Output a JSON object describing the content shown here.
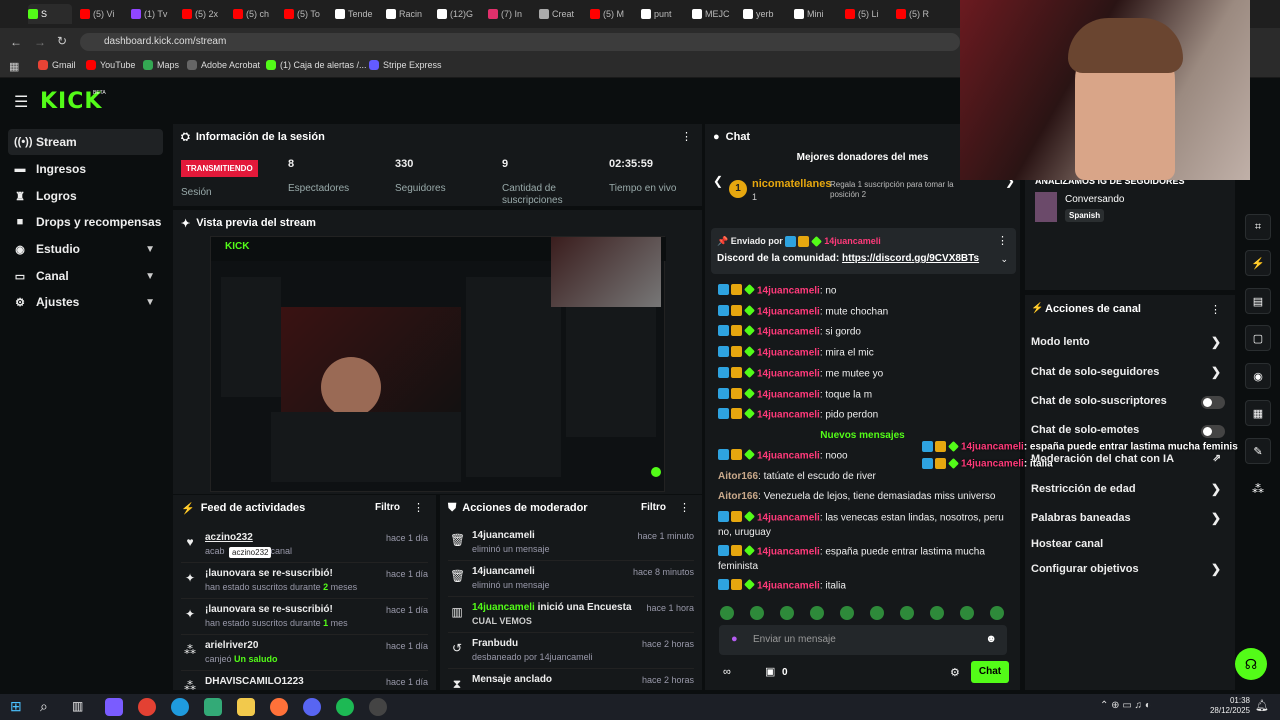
{
  "browser": {
    "tabs": [
      "S",
      "(5) Vi",
      "(1) Tv",
      "(5) 2x",
      "(5) ch",
      "(5) To",
      "Tende",
      "Racin",
      "(12)G",
      "(7) In",
      "Creat",
      "(5) M",
      "punt",
      "MEJC",
      "yerb",
      "Mini",
      "(5) Li",
      "(5) R"
    ],
    "url": "dashboard.kick.com/stream",
    "bookmarks": [
      "Gmail",
      "YouTube",
      "Maps",
      "Adobe Acrobat",
      "(1) Caja de alertas /...",
      "Stripe Express"
    ]
  },
  "brand": {
    "logo": "KICK",
    "beta": "BETA"
  },
  "sidebar": {
    "items": [
      {
        "label": "Stream",
        "icon": "stream-icon"
      },
      {
        "label": "Ingresos",
        "icon": "money-icon"
      },
      {
        "label": "Logros",
        "icon": "trophy-icon"
      },
      {
        "label": "Drops y recompensas",
        "icon": "gift-icon"
      },
      {
        "label": "Estudio",
        "icon": "studio-icon"
      },
      {
        "label": "Canal",
        "icon": "channel-icon"
      },
      {
        "label": "Ajustes",
        "icon": "gear-icon"
      }
    ]
  },
  "session": {
    "title": "Información de la sesión",
    "status_badge": "TRANSMITIENDO",
    "status_label": "Sesión",
    "stats": [
      {
        "value": "8",
        "label": "Espectadores"
      },
      {
        "value": "330",
        "label": "Seguidores"
      },
      {
        "value": "9",
        "label": "Cantidad de suscripciones"
      },
      {
        "value": "02:35:59",
        "label": "Tiempo en vivo"
      }
    ]
  },
  "preview": {
    "title": "Vista previa del stream"
  },
  "feed": {
    "title": "Feed de actividades",
    "filter": "Filtro",
    "tooltip": "aczino232",
    "items": [
      {
        "title": "aczino232",
        "sub_prefix": "acab",
        "sub_rest": "canal",
        "time": "hace 1 día",
        "icon": "heart-icon"
      },
      {
        "title": "¡launovara se re-suscribió!",
        "sub_prefix": "han estado suscritos durante ",
        "sub_hl": "2",
        "sub_rest": " meses",
        "time": "hace 1 día",
        "icon": "sparkle-icon"
      },
      {
        "title": "¡launovara se re-suscribió!",
        "sub_prefix": "han estado suscritos durante ",
        "sub_hl": "1",
        "sub_rest": " mes",
        "time": "hace 1 día",
        "icon": "sparkle-icon"
      },
      {
        "title": "arielriver20",
        "sub_prefix": "canjeó ",
        "sub_hl": "Un saludo",
        "sub_rest": "",
        "time": "hace 1 día",
        "icon": "reward-icon"
      },
      {
        "title": "DHAVISCAMILO1223",
        "sub_prefix": "",
        "sub_hl": "",
        "sub_rest": "",
        "time": "hace 1 día",
        "icon": "reward-icon"
      }
    ]
  },
  "modactions": {
    "title": "Acciones de moderador",
    "filter": "Filtro",
    "items": [
      {
        "title": "14juancameli",
        "sub": "eliminó un mensaje",
        "time": "hace 1 minuto",
        "icon": "trash-icon"
      },
      {
        "title": "14juancameli",
        "sub": "eliminó un mensaje",
        "time": "hace 8 minutos",
        "icon": "trash-icon"
      },
      {
        "title": "14juancameli",
        "title_rest": " inició una Encuesta",
        "sub": "CUAL VEMOS",
        "time": "hace 1 hora",
        "icon": "poll-icon"
      },
      {
        "title": "Franbudu",
        "sub": "desbaneado por 14juancameli",
        "time": "hace 2 horas",
        "icon": "unban-icon"
      },
      {
        "title": "Mensaje anclado",
        "sub": "",
        "time": "hace 2 horas",
        "icon": "pin-icon"
      }
    ]
  },
  "chat": {
    "title": "Chat",
    "top_donors_title": "Mejores donadores del mes",
    "donor_name": "nicomatellanes",
    "donor_rank": "1",
    "donor_count": "1",
    "donor_cta": "Regala 1 suscripción para tomar la posición 2",
    "pinned_by_prefix": "Enviado por",
    "pinned_user": "14juancameli",
    "pinned_text": "Discord de la comunidad: ",
    "pinned_link": "https://discord.gg/9CVX8BTs",
    "new_messages": "Nuevos mensajes",
    "input_placeholder": "Enviar un mensaje",
    "send": "Chat",
    "points": "0",
    "messages": [
      {
        "user": "14juancameli",
        "text": "no"
      },
      {
        "user": "14juancameli",
        "text": "mute chochan"
      },
      {
        "user": "14juancameli",
        "text": "si gordo"
      },
      {
        "user": "14juancameli",
        "text": "mira el mic"
      },
      {
        "user": "14juancameli",
        "text": "me mutee yo"
      },
      {
        "user": "14juancameli",
        "text": "toque la m"
      },
      {
        "user": "14juancameli",
        "text": "pido perdon"
      }
    ],
    "messages_after": [
      {
        "user": "14juancameli",
        "text": "nooo",
        "badges": true
      },
      {
        "user": "Aitor166",
        "text": "tatúate el escudo de river",
        "badges": false
      },
      {
        "user": "Aitor166",
        "text": "Venezuela de lejos, tiene demasiadas miss universo",
        "badges": false
      },
      {
        "user": "14juancameli",
        "text": "las venecas estan lindas, nosotros, peru no, uruguay",
        "badges": true
      },
      {
        "user": "14juancameli",
        "text": "españa puede entrar lastima mucha feminista",
        "badges": true
      },
      {
        "user": "14juancameli",
        "text": "italia",
        "badges": true
      }
    ],
    "overlay": [
      {
        "user": "14juancameli",
        "text": "españa puede entrar lastima mucha feminista"
      },
      {
        "user": "14juancameli",
        "text": "italia"
      }
    ]
  },
  "right": {
    "stream_title": "ANALIZAMOS IG DE SEGUIDORES",
    "category": "Conversando",
    "language": "Spanish",
    "actions_title": "Acciones de canal",
    "actions": [
      {
        "label": "Modo lento",
        "type": "chevron"
      },
      {
        "label": "Chat de solo-seguidores",
        "type": "chevron"
      },
      {
        "label": "Chat de solo-suscriptores",
        "type": "toggle"
      },
      {
        "label": "Chat de solo-emotes",
        "type": "toggle"
      },
      {
        "label": "Moderación del chat con IA",
        "type": "external"
      },
      {
        "label": "Restricción de edad",
        "type": "chevron"
      },
      {
        "label": "Palabras baneadas",
        "type": "chevron"
      },
      {
        "label": "Hostear canal",
        "type": "none"
      },
      {
        "label": "Configurar objetivos",
        "type": "chevron"
      }
    ]
  },
  "taskbar": {
    "time": "01:38",
    "date": "28/12/2025"
  }
}
